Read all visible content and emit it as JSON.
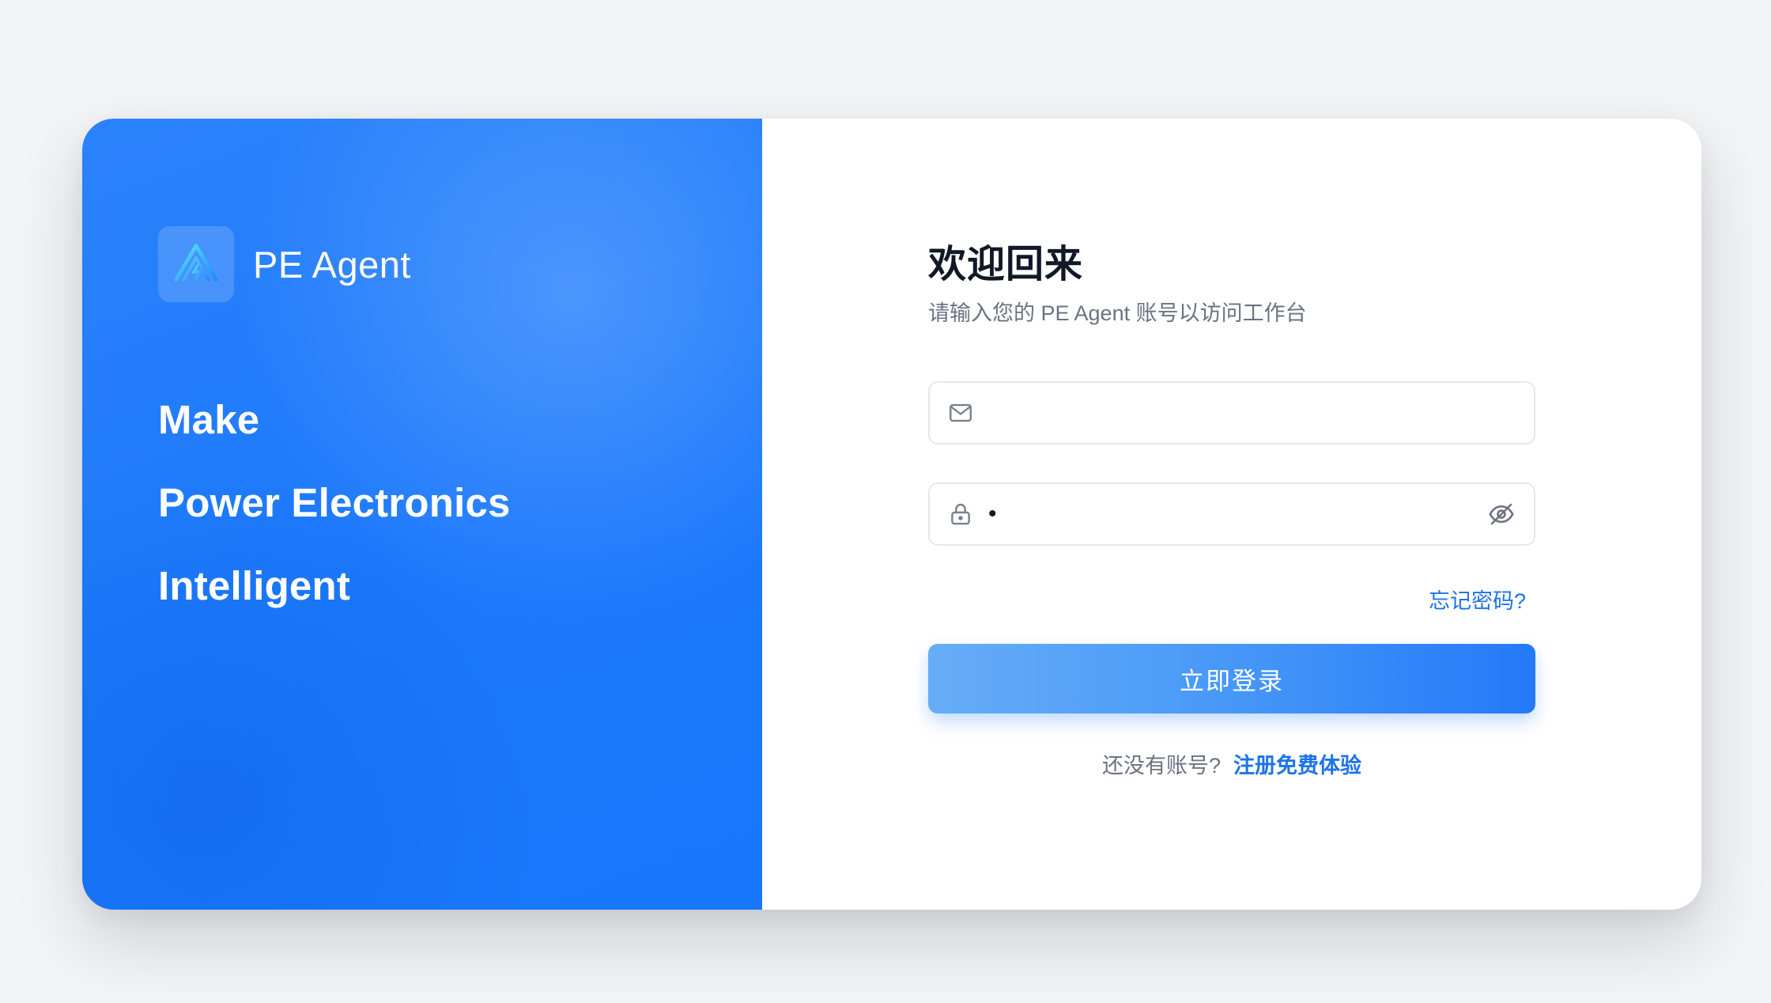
{
  "brand": {
    "name": "PE Agent",
    "logo_icon": "bolt-peak-logo-icon",
    "slogan": [
      "Make",
      "Power Electronics",
      "Intelligent"
    ]
  },
  "login": {
    "title": "欢迎回来",
    "subtitle": "请输入您的 PE Agent 账号以访问工作台",
    "email": {
      "icon": "mail-icon",
      "value": "",
      "placeholder": ""
    },
    "password": {
      "icon": "lock-icon",
      "value": "•",
      "placeholder": "",
      "toggle_icon": "eye-off-icon"
    },
    "forgot_label": "忘记密码?",
    "submit_label": "立即登录",
    "signup_prompt": "还没有账号?",
    "signup_label": "注册免费体验"
  },
  "colors": {
    "brand_blue": "#1877fb",
    "link_blue": "#1d74e8",
    "page_background": "#f3f4f6"
  }
}
